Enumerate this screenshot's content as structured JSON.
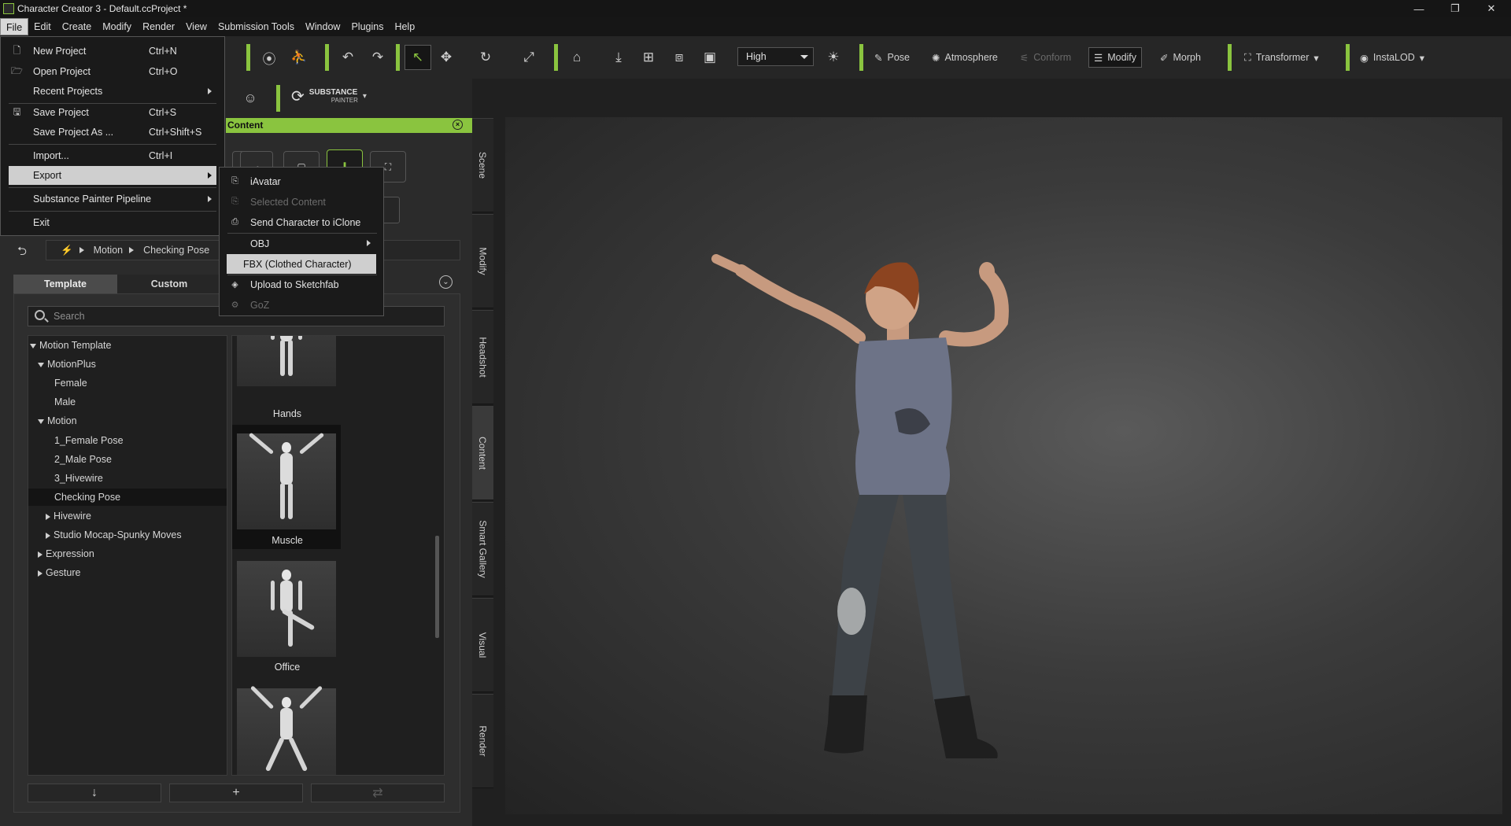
{
  "window": {
    "title": "Character Creator 3 - Default.ccProject *",
    "controls": [
      "—",
      "❐",
      "✕"
    ]
  },
  "menubar": [
    "File",
    "Edit",
    "Create",
    "Modify",
    "Render",
    "View",
    "Submission Tools",
    "Window",
    "Plugins",
    "Help"
  ],
  "file_menu": {
    "items": [
      {
        "label": "New Project",
        "shortcut": "Ctrl+N",
        "icon": "new-file-icon"
      },
      {
        "label": "Open Project",
        "shortcut": "Ctrl+O",
        "icon": "folder-open-icon"
      },
      {
        "label": "Recent Projects",
        "shortcut": "",
        "icon": ""
      },
      {
        "label": "Save Project",
        "shortcut": "Ctrl+S",
        "icon": "save-icon"
      },
      {
        "label": "Save Project As ...",
        "shortcut": "Ctrl+Shift+S",
        "icon": ""
      },
      {
        "label": "Import...",
        "shortcut": "Ctrl+I",
        "icon": ""
      },
      {
        "label": "Export",
        "shortcut": "",
        "icon": ""
      },
      {
        "label": "Substance Painter Pipeline",
        "shortcut": "",
        "icon": ""
      },
      {
        "label": "Exit",
        "shortcut": "",
        "icon": ""
      }
    ]
  },
  "export_menu": {
    "items": [
      {
        "label": "iAvatar",
        "enabled": true
      },
      {
        "label": "Selected Content",
        "enabled": false
      },
      {
        "label": "Send Character to iClone",
        "enabled": true
      },
      {
        "label": "OBJ",
        "enabled": true
      },
      {
        "label": "FBX (Clothed Character)",
        "enabled": true,
        "highlighted": true
      },
      {
        "label": "Upload to Sketchfab",
        "enabled": true
      },
      {
        "label": "GoZ",
        "enabled": false
      }
    ]
  },
  "toolbar": {
    "quality": "High",
    "buttons": {
      "pose": "Pose",
      "atmosphere": "Atmosphere",
      "conform": "Conform",
      "modify": "Modify",
      "morph": "Morph",
      "transformer": "Transformer",
      "instalod": "InstaLOD"
    },
    "substance_logo": "SUBSTANCE",
    "substance_sub": "PAINTER"
  },
  "content_panel": {
    "header": "Content",
    "breadcrumb": [
      "Motion",
      "Checking Pose"
    ],
    "tabs": [
      "Template",
      "Custom"
    ],
    "search_placeholder": "Search",
    "tree": [
      {
        "label": "Motion Template",
        "indent": 0,
        "expand": "down"
      },
      {
        "label": "MotionPlus",
        "indent": 1,
        "expand": "down"
      },
      {
        "label": "Female",
        "indent": 2,
        "expand": ""
      },
      {
        "label": "Male",
        "indent": 2,
        "expand": ""
      },
      {
        "label": "Motion",
        "indent": 1,
        "expand": "down"
      },
      {
        "label": "1_Female Pose",
        "indent": 2,
        "expand": ""
      },
      {
        "label": "2_Male Pose",
        "indent": 2,
        "expand": ""
      },
      {
        "label": "3_Hivewire",
        "indent": 2,
        "expand": ""
      },
      {
        "label": "Checking Pose",
        "indent": 2,
        "expand": "",
        "selected": true
      },
      {
        "label": "Hivewire",
        "indent": 2,
        "expand": "right"
      },
      {
        "label": "Studio Mocap-Spunky Moves",
        "indent": 2,
        "expand": "right"
      },
      {
        "label": "Expression",
        "indent": 1,
        "expand": "right"
      },
      {
        "label": "Gesture",
        "indent": 1,
        "expand": "right"
      }
    ],
    "thumbnails": [
      "Hands",
      "Muscle",
      "Office",
      ""
    ],
    "bottom_buttons": [
      "↓",
      "+",
      "⇄"
    ]
  },
  "side_tabs": [
    "Scene",
    "Modify",
    "Headshot",
    "Content",
    "Smart Gallery",
    "Visual",
    "Render"
  ]
}
